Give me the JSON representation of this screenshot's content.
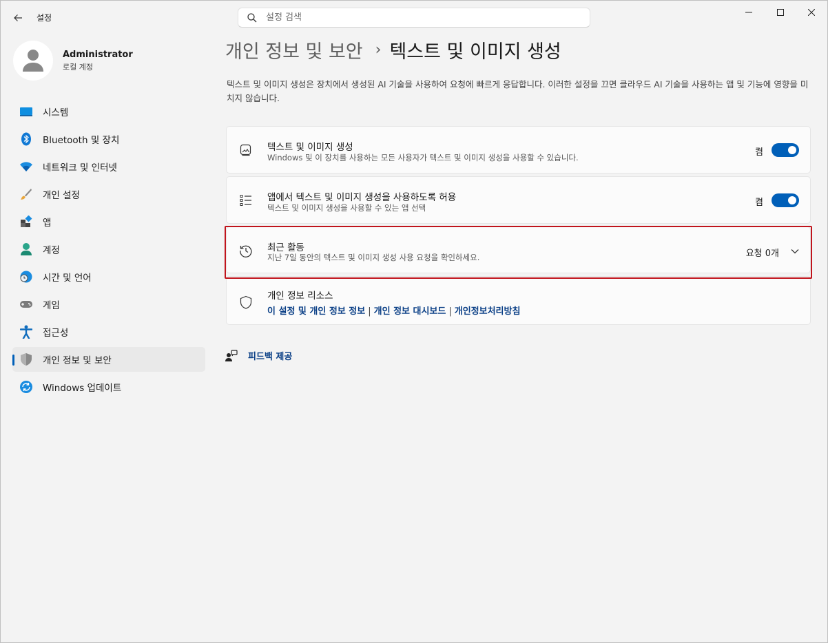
{
  "app": {
    "title": "설정"
  },
  "search": {
    "placeholder": "설정 검색"
  },
  "profile": {
    "name": "Administrator",
    "account_type": "로컬 계정"
  },
  "sidebar": {
    "items": [
      {
        "label": "시스템",
        "icon": "system-icon"
      },
      {
        "label": "Bluetooth 및 장치",
        "icon": "bluetooth-icon"
      },
      {
        "label": "네트워크 및 인터넷",
        "icon": "wifi-icon"
      },
      {
        "label": "개인 설정",
        "icon": "brush-icon"
      },
      {
        "label": "앱",
        "icon": "apps-icon"
      },
      {
        "label": "계정",
        "icon": "account-icon"
      },
      {
        "label": "시간 및 언어",
        "icon": "time-language-icon"
      },
      {
        "label": "게임",
        "icon": "gamepad-icon"
      },
      {
        "label": "접근성",
        "icon": "accessibility-icon"
      },
      {
        "label": "개인 정보 및 보안",
        "icon": "shield-icon",
        "active": true
      },
      {
        "label": "Windows 업데이트",
        "icon": "update-icon"
      }
    ]
  },
  "breadcrumb": {
    "parent": "개인 정보 및 보안",
    "separator": "›",
    "current": "텍스트 및 이미지 생성"
  },
  "description": "텍스트 및 이미지 생성은 장치에서 생성된 AI 기술을 사용하여 요청에 빠르게 응답합니다. 이러한 설정을 끄면 클라우드 AI 기술을 사용하는 앱 및 기능에 영향을 미치지 않습니다.",
  "settings": {
    "text_image_gen": {
      "title": "텍스트 및 이미지 생성",
      "subtitle": "Windows 및 이 장치를 사용하는 모든 사용자가 텍스트 및 이미지 생성을 사용할 수 있습니다.",
      "state_label": "켬",
      "enabled": true
    },
    "allow_apps": {
      "title": "앱에서 텍스트 및 이미지 생성을 사용하도록 허용",
      "subtitle": "텍스트 및 이미지 생성을 사용할 수 있는 앱 선택",
      "state_label": "켬",
      "enabled": true
    },
    "recent_activity": {
      "title": "최근 활동",
      "subtitle": "지난 7일 동안의 텍스트 및 이미지 생성 사용 요청을 확인하세요.",
      "count_label": "요청 0개"
    },
    "privacy_resources": {
      "title": "개인 정보 리소스",
      "links": [
        "이 설정 및 개인 정보 정보",
        "개인 정보 대시보드",
        "개인정보처리방침"
      ],
      "separator": "|"
    }
  },
  "feedback": {
    "label": "피드백 제공"
  },
  "colors": {
    "accent": "#005fb8",
    "highlight": "#c0141c",
    "link": "#0a3f86"
  }
}
